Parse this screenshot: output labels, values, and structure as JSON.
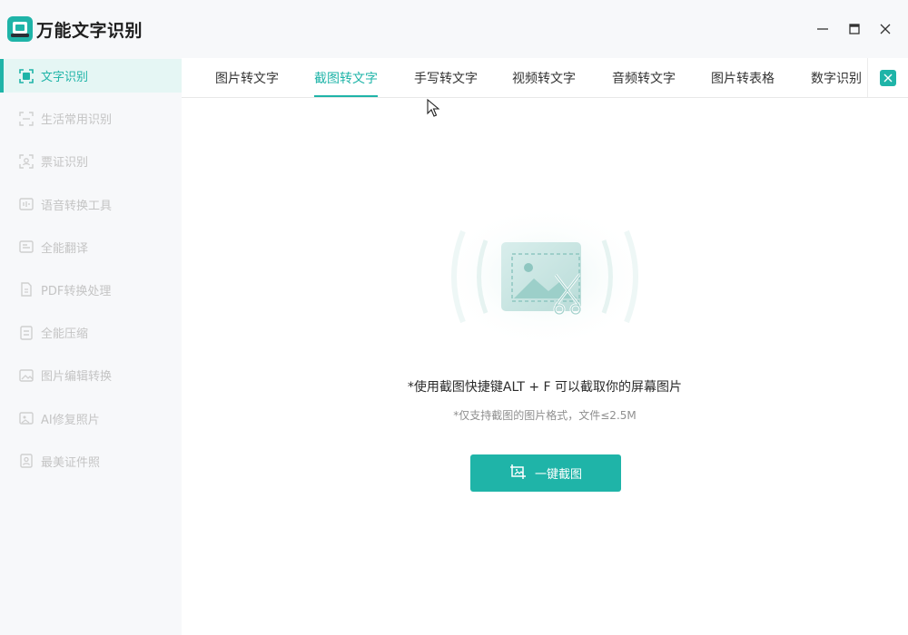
{
  "app": {
    "title": "万能文字识别"
  },
  "sidebar": {
    "items": [
      {
        "label": "文字识别",
        "icon": "text-scan-icon",
        "active": true
      },
      {
        "label": "生活常用识别",
        "icon": "scan-frame-icon"
      },
      {
        "label": "票证识别",
        "icon": "id-scan-icon"
      },
      {
        "label": "语音转换工具",
        "icon": "audio-convert-icon"
      },
      {
        "label": "全能翻译",
        "icon": "translate-icon"
      },
      {
        "label": "PDF转换处理",
        "icon": "pdf-icon"
      },
      {
        "label": "全能压缩",
        "icon": "compress-icon"
      },
      {
        "label": "图片编辑转换",
        "icon": "image-edit-icon"
      },
      {
        "label": "AI修复照片",
        "icon": "ai-repair-icon"
      },
      {
        "label": "最美证件照",
        "icon": "id-photo-icon"
      }
    ]
  },
  "tabs": [
    {
      "label": "图片转文字"
    },
    {
      "label": "截图转文字",
      "active": true
    },
    {
      "label": "手写转文字"
    },
    {
      "label": "视频转文字"
    },
    {
      "label": "音频转文字"
    },
    {
      "label": "图片转表格"
    },
    {
      "label": "数字识别"
    }
  ],
  "main": {
    "hint_main": "*使用截图快捷键ALT + F 可以截取你的屏幕图片",
    "hint_sub": "*仅支持截图的图片格式，文件≤2.5M",
    "button_label": "一键截图"
  },
  "colors": {
    "accent": "#1fb4a8",
    "active_bg": "#e5f6f4",
    "sidebar_bg": "#f7f8fa"
  }
}
